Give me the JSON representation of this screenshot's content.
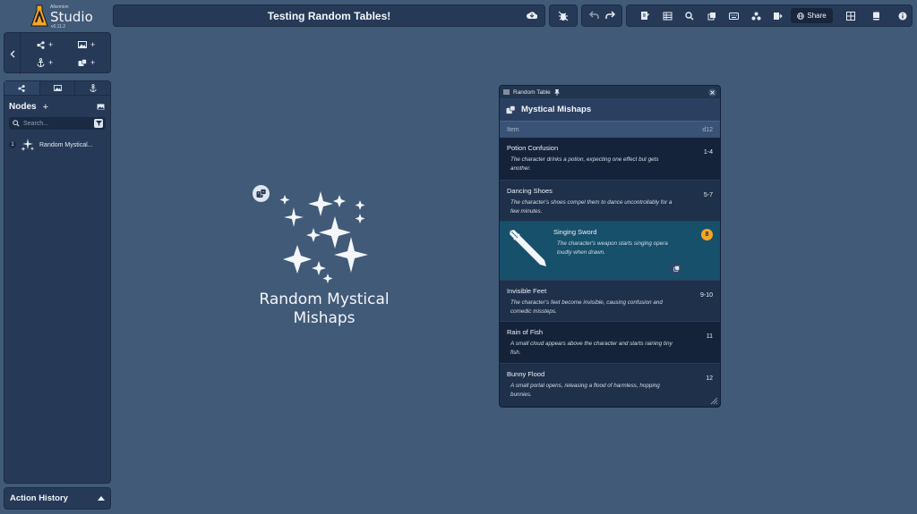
{
  "app": {
    "brand_small": "Alkemion",
    "brand_name": "Studio",
    "version": "v0.11.2"
  },
  "toolbar": {
    "document_title": "Testing Random Tables!",
    "share_label": "Share",
    "icons": [
      "cloud-icon",
      "bug-icon",
      "undo-icon",
      "redo-icon",
      "edit-note-icon",
      "table-icon",
      "search-icon",
      "copy-icon",
      "keyboard-icon",
      "nodes-icon",
      "export-icon",
      "globe-icon",
      "grid-icon",
      "book-icon",
      "info-icon"
    ]
  },
  "add_panel": {
    "back_icon": "chevron-left-icon",
    "items": [
      {
        "icon": "share-nodes-icon",
        "label": "+"
      },
      {
        "icon": "image-icon",
        "label": "+"
      },
      {
        "icon": "anchor-icon",
        "label": "+"
      },
      {
        "icon": "dice-icon",
        "label": "+"
      }
    ]
  },
  "sidebar": {
    "tabs": [
      "share-nodes-icon",
      "image-icon",
      "anchor-icon"
    ],
    "title": "Nodes",
    "add_label": "+",
    "search_placeholder": "Search...",
    "nodes": [
      {
        "index": "1",
        "label": "Random Mystical..."
      }
    ]
  },
  "history": {
    "label": "Action History"
  },
  "canvas": {
    "node_caption_line1": "Random Mystical",
    "node_caption_line2": "Mishaps"
  },
  "random_table": {
    "window_title": "Random Table",
    "title": "Mystical Mishaps",
    "col_item": "Item",
    "col_die": "d12",
    "rows": [
      {
        "name": "Potion Confusion",
        "desc": "The character drinks a potion, expecting one effect but gets another.",
        "roll": "1-4"
      },
      {
        "name": "Dancing Shoes",
        "desc": "The character's shoes compel them to dance uncontrollably for a few minutes.",
        "roll": "5-7"
      },
      {
        "name": "Singing Sword",
        "desc": "The character's weapon starts singing opera loudly when drawn.",
        "roll": "8",
        "selected": true
      },
      {
        "name": "Invisible Feet",
        "desc": "The character's feet become invisible, causing confusion and comedic missteps.",
        "roll": "9-10"
      },
      {
        "name": "Rain of Fish",
        "desc": "A small cloud appears above the character and starts raining tiny fish.",
        "roll": "11"
      },
      {
        "name": "Bunny Flood",
        "desc": "A small portal opens, releasing a flood of harmless, hopping bunnies.",
        "roll": "12"
      }
    ]
  }
}
